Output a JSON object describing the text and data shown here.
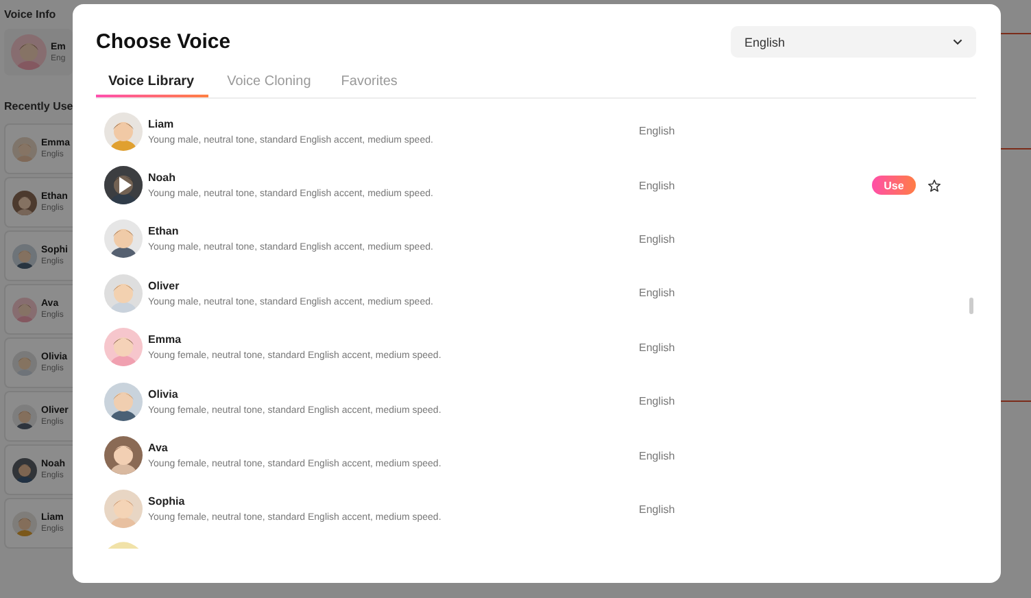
{
  "background": {
    "voice_info_title": "Voice Info",
    "current_voice": {
      "name": "Em",
      "language": "Eng"
    },
    "recently_used_title": "Recently Use",
    "recent": [
      {
        "name": "Emma",
        "language": "Englis"
      },
      {
        "name": "Ethan",
        "language": "Englis"
      },
      {
        "name": "Sophi",
        "language": "Englis"
      },
      {
        "name": "Ava",
        "language": "Englis"
      },
      {
        "name": "Olivia",
        "language": "Englis"
      },
      {
        "name": "Oliver",
        "language": "Englis"
      },
      {
        "name": "Noah",
        "language": "Englis"
      },
      {
        "name": "Liam",
        "language": "Englis"
      }
    ]
  },
  "dialog": {
    "title": "Choose Voice",
    "language_select": {
      "value": "English"
    },
    "tabs": [
      {
        "label": "Voice Library",
        "selected": true
      },
      {
        "label": "Voice Cloning",
        "selected": false
      },
      {
        "label": "Favorites",
        "selected": false
      }
    ],
    "use_button": "Use",
    "voices": [
      {
        "name": "Liam",
        "description": "Young male, neutral tone, standard English accent, medium speed.",
        "language": "English",
        "hovered": false
      },
      {
        "name": "Noah",
        "description": "Young male, neutral tone, standard English accent, medium speed.",
        "language": "English",
        "hovered": true
      },
      {
        "name": "Ethan",
        "description": "Young male, neutral tone, standard English accent, medium speed.",
        "language": "English",
        "hovered": false
      },
      {
        "name": "Oliver",
        "description": "Young male, neutral tone, standard English accent, medium speed.",
        "language": "English",
        "hovered": false
      },
      {
        "name": "Emma",
        "description": "Young female, neutral tone, standard English accent, medium speed.",
        "language": "English",
        "hovered": false
      },
      {
        "name": "Olivia",
        "description": "Young female, neutral tone, standard English accent, medium speed.",
        "language": "English",
        "hovered": false
      },
      {
        "name": "Ava",
        "description": "Young female, neutral tone, standard English accent, medium speed.",
        "language": "English",
        "hovered": false
      },
      {
        "name": "Sophia",
        "description": "Young female, neutral tone, standard English accent, medium speed.",
        "language": "English",
        "hovered": false
      }
    ]
  }
}
